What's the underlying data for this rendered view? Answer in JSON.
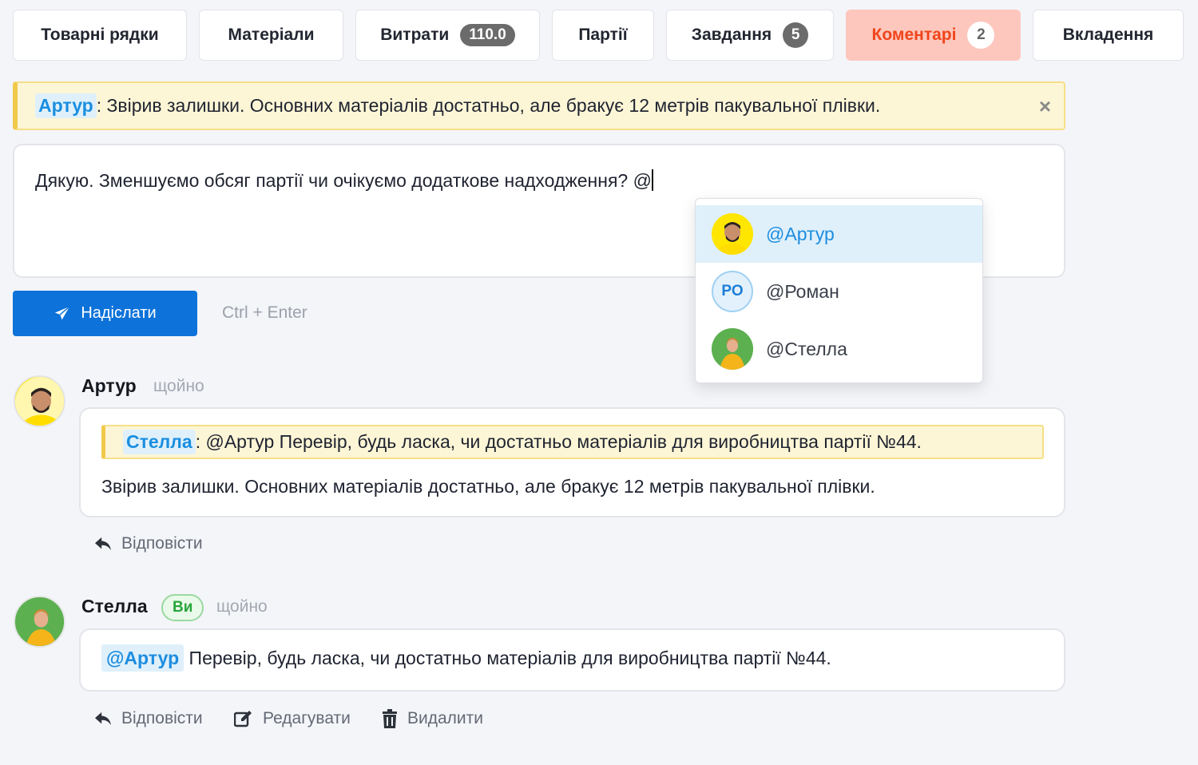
{
  "tabs": [
    {
      "label": "Товарні рядки"
    },
    {
      "label": "Матеріали"
    },
    {
      "label": "Витрати",
      "badge": "110.0"
    },
    {
      "label": "Партії"
    },
    {
      "label": "Завдання",
      "badge": "5"
    },
    {
      "label": "Коментарі",
      "badge": "2",
      "active": true
    },
    {
      "label": "Вкладення"
    }
  ],
  "reply_bar": {
    "author": "Артур",
    "text": ": Звірив залишки. Основних матеріалів достатньо, але бракує 12 метрів пакувальної плівки.",
    "close": "×"
  },
  "composer": {
    "value": "Дякую. Зменшуємо обсяг партії чи очікуємо додаткове надходження? @"
  },
  "send_button": {
    "label": "Надіслати",
    "icon": "paper-plane-icon"
  },
  "send_hint": "Ctrl + Enter",
  "mention_dropdown": {
    "items": [
      {
        "label": "@Артур",
        "avatar": "photo"
      },
      {
        "label": "@Роман",
        "avatar": "initials",
        "initials": "РО"
      },
      {
        "label": "@Стелла",
        "avatar": "photo"
      }
    ]
  },
  "comments": [
    {
      "author": "Артур",
      "time": "щойно",
      "quote_author": "Стелла",
      "quote_text": ": @Артур Перевір, будь ласка, чи достатньо матеріалів для виробництва партії №44.",
      "body": "Звірив залишки. Основних матеріалів достатньо, але бракує 12 метрів пакувальної плівки.",
      "actions": {
        "reply": "Відповісти"
      }
    },
    {
      "author": "Стелла",
      "you_badge": "Ви",
      "time": "щойно",
      "mention": "@Артур",
      "body": " Перевір, будь ласка, чи достатньо матеріалів для виробництва партії №44.",
      "actions": {
        "reply": "Відповісти",
        "edit": "Редагувати",
        "delete": "Видалити"
      }
    }
  ],
  "colors": {
    "accent": "#0d72d9",
    "active_tab_bg": "#fdc7bd",
    "active_tab_text": "#f0441b",
    "mention": "#1d8de0",
    "quote_bg": "#fdf6d6"
  }
}
